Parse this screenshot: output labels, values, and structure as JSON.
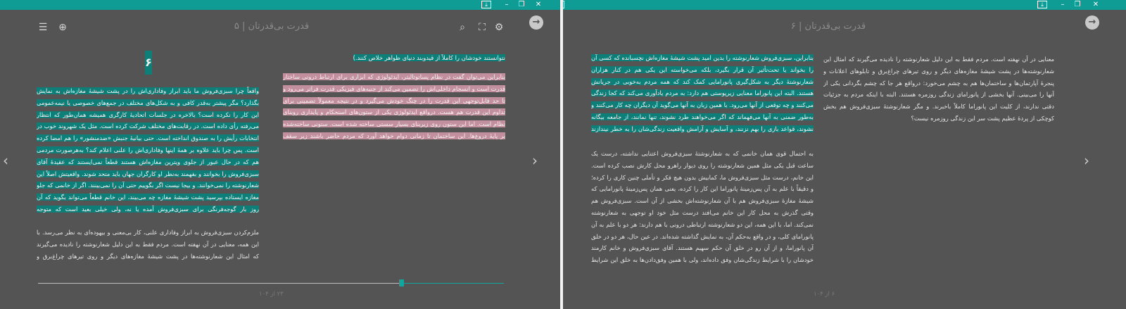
{
  "colors": {
    "titlebar": "#0e9c95",
    "background": "#545454",
    "highlight_teal": "#0e7e78",
    "highlight_pink": "#c28f9f",
    "progress": "#10a79f"
  },
  "left_window": {
    "header_title": "قدرت بی‌قدرتان | ۵",
    "icons": [
      "list-icon",
      "zoom-icon",
      "search-icon",
      "fullscreen-icon",
      "settings-icon",
      "back-arrow-icon"
    ],
    "chapter_number": "۶",
    "col_right_p1": "نتوانستند خودشان را کاملاً از قیدوبند دنیای ظواهر خلاص کنند.)",
    "col_right_p2": "بنابراین می‌توان گفت در نظام پساتوتالیتر، ایدئولوژی که ابزاری برای ارتباط درونی ساختار قدرت است و انسجام داخلی‌اش را تضمین می‌کند از جنبه‌های فیزیکی قدرت فراتر می‌رود و تا حد قابل‌توجهی این قدرت را در چنگ خودش می‌گیرد و در نتیجه معمولاً تضمینی برای تداوم این قدرت هم هست. درواقع ایدئولوژی یکی از ستون‌های استحکام و پایداری روبنای نظام است. اما این ستون روی زیربنای بسیار سستی ساخته شده است. ستونی ساخته‌شده بر پایهٔ دروغ‌ها. این ساختمان تا زمانی دوام خواهد آورد که مردم حاضر باشند زیر سقف دروغ زندگی کنند.",
    "col_left_p1": "واقعاً چرا سبزی‌فروش ما باید ابراز وفاداری‌اش را در پشت شیشهٔ مغازه‌اش به نمایش بگذارد؟ مگر پیشتر به‌قدر کافی و به شکل‌های مختلف در جمع‌های خصوصی یا نیمه‌عمومی این کار را نکرده است؟ بالاخره در جلسات اتحادیهٔ کارگری همیشه همان‌طور که انتظار می‌رفته رأی داده است. در رقابت‌های مختلف شرکت کرده است. مثل یک شهروند خوب در انتخابات رأیش را به صندوق انداخته است. حتی بیانیهٔ جنبش «ضدمنشور» را هم امضا کرده است. پس چرا باید علاوه بر همهٔ اینها وفاداری‌اش را علنی اعلام کند؟ به‌هرصورت مردمی هم که در حال عبور از جلوی ویترین مغازه‌اش هستند قطعاً نمی‌ایستند که عقیدهٔ آقای سبزی‌فروش را بخوانند و بفهمند به‌نظر او کارگران جهان باید متحد شوند. واقعیتش اصلاً این شعارنوشته را نمی‌خوانند. و بیجا نیست اگر بگوییم حتی آن را نمی‌بینند. اگر از خانمی که جلو مغازه ایستاده بپرسید پشت شیشهٔ مغازه چه می‌بیند، این خانم قطعاً می‌تواند بگوید که آن روز بار گوجه‌فرنگی برای سبزی‌فروش آمده یا نه، ولی خیلی بعید است که متوجه شعارنوشته شده باشد، چه برسد به محتوای آن.",
    "col_left_p2": "ملزم‌کردن سبزی‌فروش به ابراز وفاداری علنی، کار بی‌معنی و بیهوده‌ای به نظر می‌رسد. با این همه، معنایی در آن نهفته است. مردم فقط به این دلیل شعارنوشته را نادیده می‌گیرند که امثال این شعارنوشته‌ها در پشت شیشهٔ مغازه‌های دیگر و روی تیرهای چراغ‌برق و تابلوهای اعلانات و پنجرهٔ",
    "progress_fraction": 0.78,
    "page_indicator": "۲۳ از ۱۰۴"
  },
  "right_window": {
    "header_title": "قدرت بی‌قدرتان | ۶",
    "icons": [
      "back-arrow-icon"
    ],
    "col_right_p1": "معنایی در آن نهفته است. مردم فقط به این دلیل شعارنوشته را نادیده می‌گیرند که امثال این شعارنوشته‌ها در پشت شیشهٔ مغازه‌های دیگر و روی تیرهای چراغ‌برق و تابلوهای اعلانات و پنجرهٔ آپارتمان‌ها و ساختمان‌ها هم به چشم می‌خورد: درواقع هر جا که چشم بگردانی یکی از آنها را می‌بینی. آنها بخشی از پانورامای زندگی روزمره هستند. البته با اینکه مردم به جزئیات دقتی ندارند، از کلیت این پانوراما کاملاً باخبرند. و مگر شعارنوشتهٔ سبزی‌فروش هم بخش کوچکی از پردهٔ عظیم پشت سر این زندگی روزمره نیست؟",
    "col_left_p1": "بنابراین، سبزی‌فروش شعارنوشته را بدین امید پشت شیشهٔ مغازه‌اش نچسبانده که کسی آن را بخواند یا تحت‌تأثیر آن قرار بگیرد، بلکه می‌خواسته این یکی هم در کنار هزاران شعارنوشتهٔ دیگر به شکل‌گیری پانورامایی کمک کند که همه مردم به‌خوبی در جریانش هستند. البته این پانوراما معنایی زیرپوستی هم دارد: به مردم یادآوری می‌کند که کجا زندگی می‌کنند و چه توقعی از آنها می‌رود. با همین زبان به آنها می‌گوید آن دیگران چه کار می‌کنند و به‌طور ضمنی به آنها می‌فهماند که اگر می‌خواهند طرد نشوند، تنها نمانند، از جامعه بیگانه نشوند، قواعد بازی را بهم نزنند، و آسایش و آرامش واقعیت زندگی‌شان را به خطر نیندازند چه کار باید بکنند.",
    "col_left_p2": "به احتمال قوی همان خانمی که به شعارنوشتهٔ سبزی‌فروش اعتنایی نداشته، درست یک ساعت قبل یکی مثل همین شعارنوشته را روی دیوار راهرو محل کارش نصب کرده است. این خانم، درست مثل سبزی‌فروش ما، کمابیش بدون هیچ فکر و تأملی چنین کاری را کرده؛ و دقیقاً با علم به آن پس‌زمینهٔ پانوراما این کار را کرده، یعنی همان پس‌زمینهٔ پانورامایی که شیشهٔ مغازهٔ سبزی‌فروش هم با آن شعارنوشته‌اش بخشی از آن است. سبزی‌فروش هم وقتی گذرش به محل کار این خانم می‌افتد درست مثل خود او توجهی به شعارنوشته نمی‌کند. اما، با این همه، این دو شعارنوشته ارتباطی درونی با هم دارند: هر دو با علم به آن پانورامای کلی، و در واقع به‌حکم آن، به نمایش گذاشته شده‌اند. در عین حال، هر دو در خلق آن پانوراما، و از آن رو در خلق آن حکم سهیم هستند. آقای سبزی‌فروش و خانم کارمند خودشان را با شرایط زندگی‌شان وفق داده‌اند، ولی با همین وفق‌دادن‌ها به خلق این شرایط کمک کرده‌اند. کاری را می‌کنند که بقیه می‌کنند، کاری که قرار است انجام شود، کاری که باید انجام",
    "page_indicator": "۶ از ۱۰۴"
  }
}
